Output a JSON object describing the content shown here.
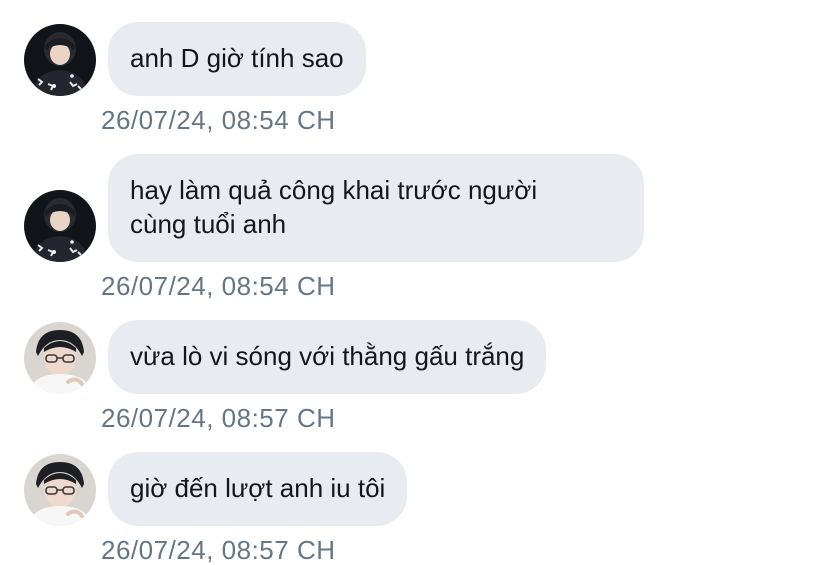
{
  "messages": [
    {
      "avatar": "avatar-dark-hoodie",
      "text": "anh D giờ tính sao",
      "timestamp": "26/07/24, 08:54 CH"
    },
    {
      "avatar": "avatar-dark-hoodie",
      "text": "hay làm quả công khai trước người cùng tuổi anh",
      "line1": "hay làm quả công khai trước người",
      "line2": "cùng tuổi anh",
      "timestamp": "26/07/24, 08:54 CH"
    },
    {
      "avatar": "avatar-glasses-white-shirt",
      "text": "vừa lò vi sóng với thằng gấu trắng",
      "timestamp": "26/07/24, 08:57 CH"
    },
    {
      "avatar": "avatar-glasses-white-shirt",
      "text": "giờ đến lượt anh iu tôi",
      "timestamp": "26/07/24, 08:57 CH"
    }
  ],
  "colors": {
    "bubble": "#e8ebef",
    "text": "#14171a",
    "timestamp": "#657786"
  }
}
